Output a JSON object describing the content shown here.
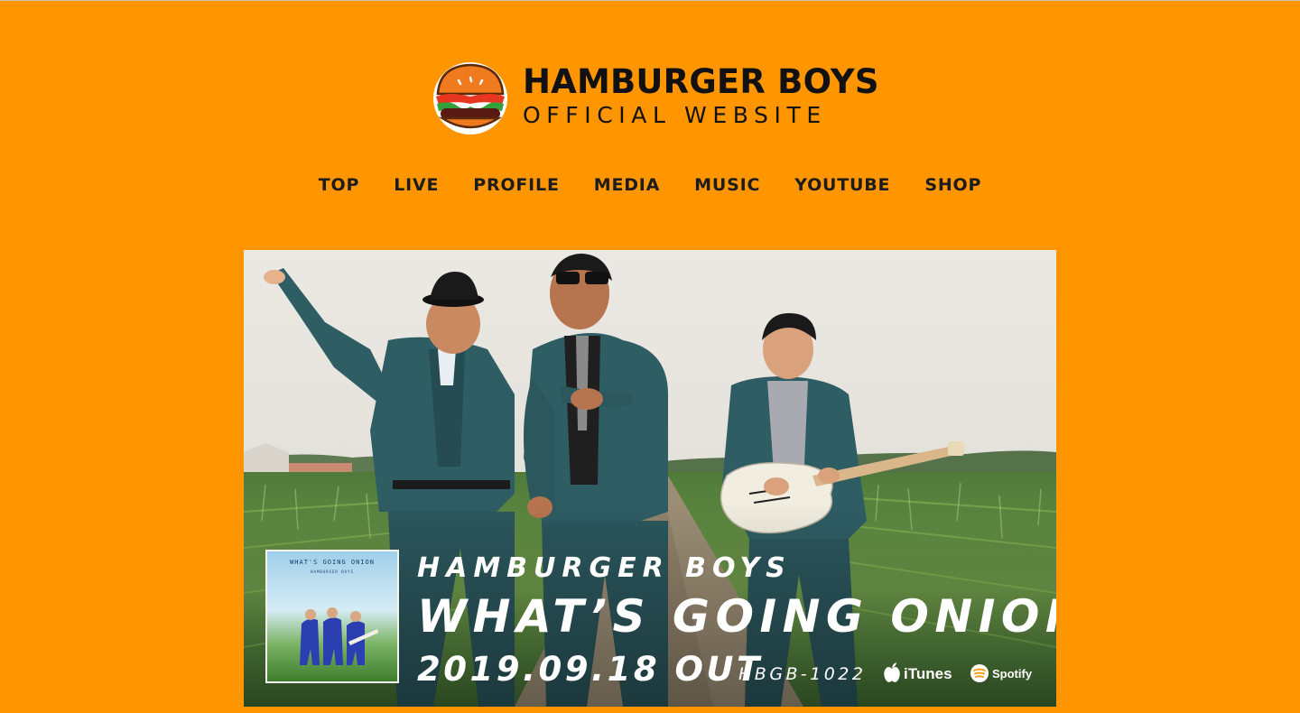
{
  "site": {
    "title": "HAMBURGER BOYS",
    "subtitle": "OFFICIAL WEBSITE",
    "logo_icon": "hamburger-icon"
  },
  "nav": {
    "items": [
      {
        "label": "TOP"
      },
      {
        "label": "LIVE"
      },
      {
        "label": "PROFILE"
      },
      {
        "label": "MEDIA"
      },
      {
        "label": "MUSIC"
      },
      {
        "label": "YOUTUBE"
      },
      {
        "label": "SHOP"
      }
    ]
  },
  "hero": {
    "artist": "HAMBURGER BOYS",
    "title": "WHAT’S GOING ONION",
    "release": "2019.09.18 OUT",
    "catalog": "HBGB-1022",
    "cover": {
      "title": "WHAT'S GOING ONION",
      "artist": "HAMBURGER BOYS"
    },
    "stores": [
      {
        "label": "iTunes",
        "icon": "apple-icon"
      },
      {
        "label": "Spotify",
        "icon": "spotify-icon"
      }
    ]
  },
  "colors": {
    "background": "#ff9600",
    "text": "#111111",
    "hero_text": "#ffffff",
    "suit": "#2e5d63"
  }
}
